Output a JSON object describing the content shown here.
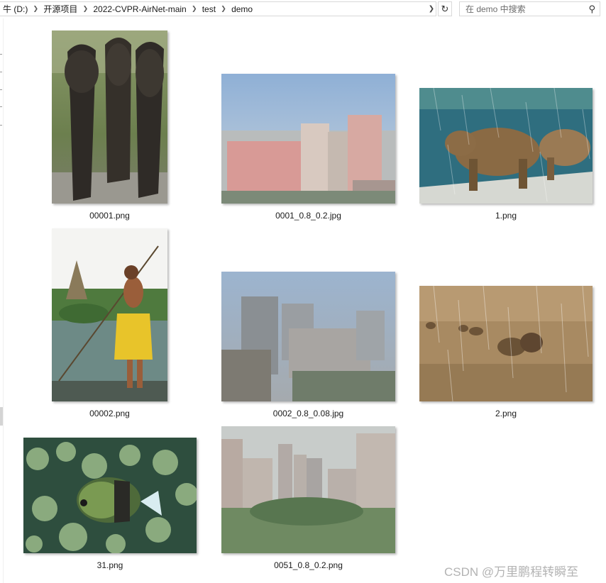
{
  "address_bar": {
    "breadcrumbs": [
      "牛 (D:)",
      "开源项目",
      "2022-CVPR-AirNet-main",
      "test",
      "demo"
    ]
  },
  "search": {
    "placeholder": "在 demo 中搜索"
  },
  "files": [
    {
      "name": "00001.png"
    },
    {
      "name": "0001_0.8_0.2.jpg"
    },
    {
      "name": "1.png"
    },
    {
      "name": "00002.png"
    },
    {
      "name": "0002_0.8_0.08.jpg"
    },
    {
      "name": "2.png"
    },
    {
      "name": "31.png"
    },
    {
      "name": "0051_0.8_0.2.png"
    }
  ],
  "watermark": {
    "text": "CSDN @万里鹏程转瞬至"
  },
  "icons": [
    "chevron-right-icon",
    "chevron-down-icon",
    "refresh-icon",
    "search-icon"
  ]
}
